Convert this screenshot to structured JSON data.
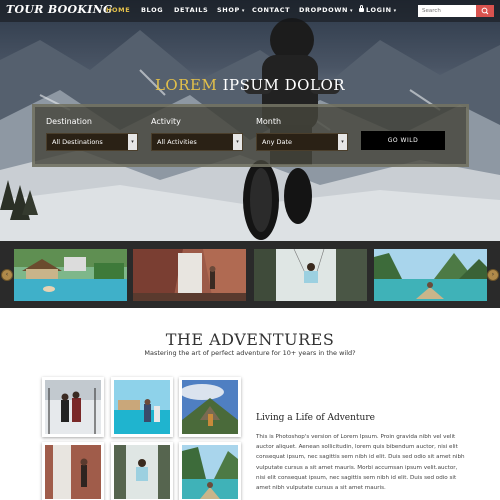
{
  "navbar": {
    "brand": "TOUR BOOKING",
    "items": [
      {
        "label": "HOME",
        "active": true
      },
      {
        "label": "BLOG"
      },
      {
        "label": "DETAILS"
      },
      {
        "label": "SHOP",
        "dropdown": true
      },
      {
        "label": "CONTACT"
      },
      {
        "label": "DROPDOWN",
        "dropdown": true
      },
      {
        "label": "LOGIN",
        "dropdown": true,
        "icon": "lock-icon"
      }
    ],
    "search_placeholder": "Search",
    "search_icon": "search-icon"
  },
  "hero": {
    "title_accent": "LOREM",
    "title_rest": "IPSUM DOLOR",
    "booking": {
      "destination_label": "Destination",
      "destination_value": "All Destinations",
      "activity_label": "Activity",
      "activity_value": "All Activities",
      "month_label": "Month",
      "month_value": "Any Date",
      "go_label": "GO WILD"
    }
  },
  "carousel": {
    "prev_icon": "chevron-left-icon",
    "next_icon": "chevron-right-icon",
    "thumbnails": [
      "resort-pool-photo",
      "canyon-waterfall-photo",
      "waterfall-swing-photo",
      "lake-boat-photo"
    ]
  },
  "adventures": {
    "title": "THE ADVENTURES",
    "subtitle": "Mastering the art of perfect adventure for 10+ years in the wild?",
    "article_title": "Living a Life of Adventure",
    "article_body": "This is Photoshop's version of Lorem Ipsum. Proin gravida nibh vel velit auctor aliquet. Aenean sollicitudin, lorem quis bibendum auctor, nisi elit consequat ipsum, nec sagittis sem nibh id elit. Duis sed odio sit amet nibh vulputate cursus a sit amet mauris. Morbi accumsan ipsum velit.auctor, nisi elit consequat ipsum, nec sagittis sem nibh id elit. Duis sed odio sit amet nibh vulputate cursus a sit amet mauris."
  },
  "colors": {
    "accent_gold": "#e3c04a",
    "search_button": "#d9534f",
    "strip_bg": "#2a2a2a",
    "carousel_arrow": "#b08a4a"
  }
}
